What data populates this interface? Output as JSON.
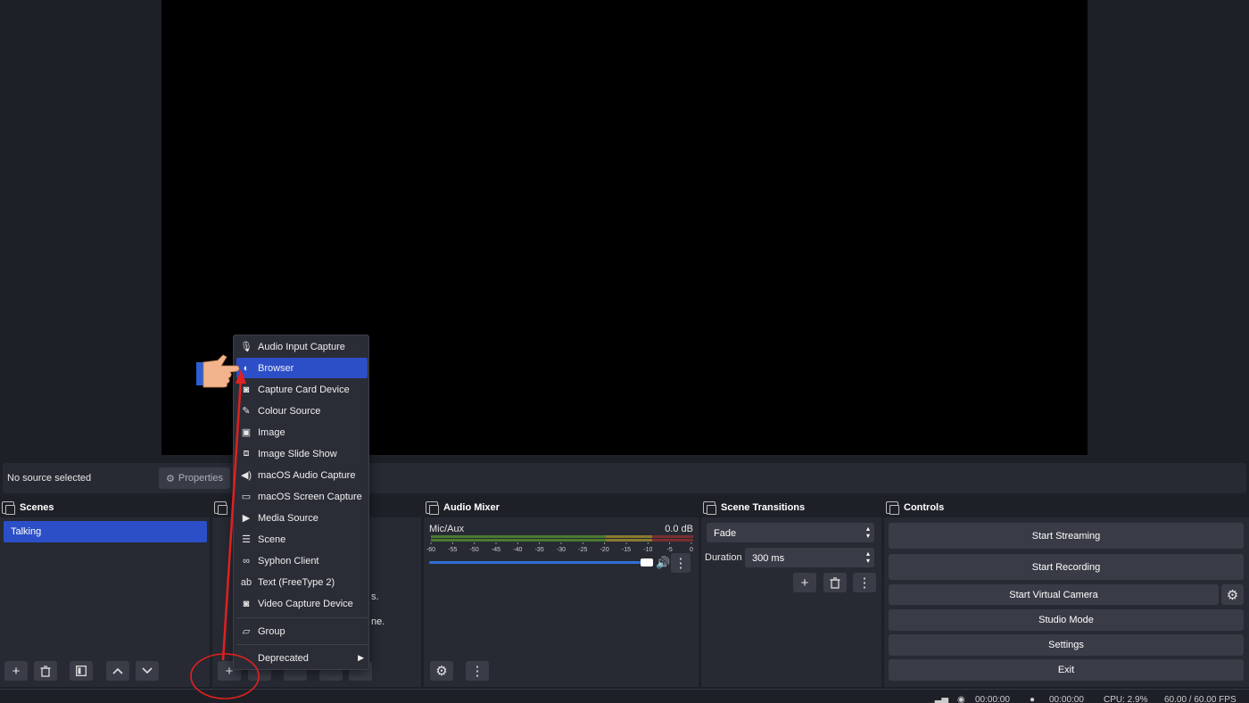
{
  "context_bar": {
    "no_source": "No source selected",
    "properties_label": "Properties"
  },
  "docks": {
    "scenes": {
      "title": "Scenes",
      "items": [
        "Talking"
      ]
    },
    "sources": {
      "hidden_text_1": "s.",
      "hidden_text_2": "ne."
    },
    "mixer": {
      "title": "Audio Mixer",
      "channel": "Mic/Aux",
      "level": "0.0 dB",
      "ticks": [
        "-60",
        "-55",
        "-50",
        "-45",
        "-40",
        "-35",
        "-30",
        "-25",
        "-20",
        "-15",
        "-10",
        "-5",
        "0"
      ],
      "volume_fraction": 0.99
    },
    "transitions": {
      "title": "Scene Transitions",
      "selected": "Fade",
      "duration_label": "Duration",
      "duration_value": "300 ms"
    },
    "controls": {
      "title": "Controls",
      "buttons": [
        "Start Streaming",
        "Start Recording",
        "Start Virtual Camera",
        "Studio Mode",
        "Settings",
        "Exit"
      ]
    }
  },
  "menu": {
    "items": [
      {
        "label": "Audio Input Capture",
        "icon": "microphone-icon"
      },
      {
        "label": "Browser",
        "icon": "globe-icon"
      },
      {
        "label": "Capture Card Device",
        "icon": "camera-icon"
      },
      {
        "label": "Colour Source",
        "icon": "brush-icon"
      },
      {
        "label": "Image",
        "icon": "image-icon"
      },
      {
        "label": "Image Slide Show",
        "icon": "slideshow-icon"
      },
      {
        "label": "macOS Audio Capture",
        "icon": "speaker-icon"
      },
      {
        "label": "macOS Screen Capture",
        "icon": "monitor-icon"
      },
      {
        "label": "Media Source",
        "icon": "play-icon"
      },
      {
        "label": "Scene",
        "icon": "list-icon"
      },
      {
        "label": "Syphon Client",
        "icon": "link-icon"
      },
      {
        "label": "Text (FreeType 2)",
        "icon": "text-icon"
      },
      {
        "label": "Video Capture Device",
        "icon": "camera-icon"
      },
      {
        "label": "Group",
        "icon": "folder-icon"
      },
      {
        "label": "Deprecated",
        "icon": ""
      }
    ],
    "highlighted": "Browser",
    "icon_glyphs": {
      "ab": "ab"
    }
  },
  "statusbar": {
    "stream_time": "00:00:00",
    "rec_time": "00:00:00",
    "cpu": "CPU: 2.9%",
    "fps": "60.00 / 60.00 FPS"
  },
  "colors": {
    "accent": "#2c4fc7",
    "annotation": "#e02020"
  }
}
